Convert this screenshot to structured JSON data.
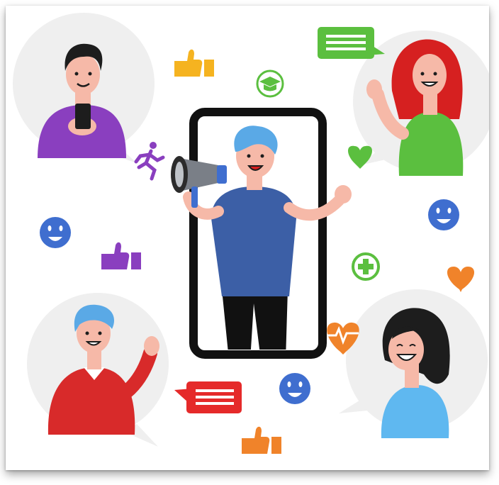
{
  "illustration": {
    "colors": {
      "bubble": "#efefef",
      "phone_frame": "#111111",
      "presenter_shirt": "#3c5fa6",
      "presenter_hair": "#5aa9e6",
      "skin": "#f6b9a8",
      "purple": "#8a3fbf",
      "green": "#5bbf3f",
      "red": "#e52a2a",
      "blue": "#3f6ecf",
      "orange": "#f0832a",
      "yellow": "#f5b320",
      "woman_shirt": "#5fb8f0"
    },
    "icons": [
      "thumbs-up-icon",
      "chat-bubble-icon",
      "graduation-cap-icon",
      "running-person-icon",
      "heart-icon",
      "smiley-icon",
      "plus-circle-icon",
      "heartbeat-icon",
      "megaphone-icon"
    ]
  }
}
